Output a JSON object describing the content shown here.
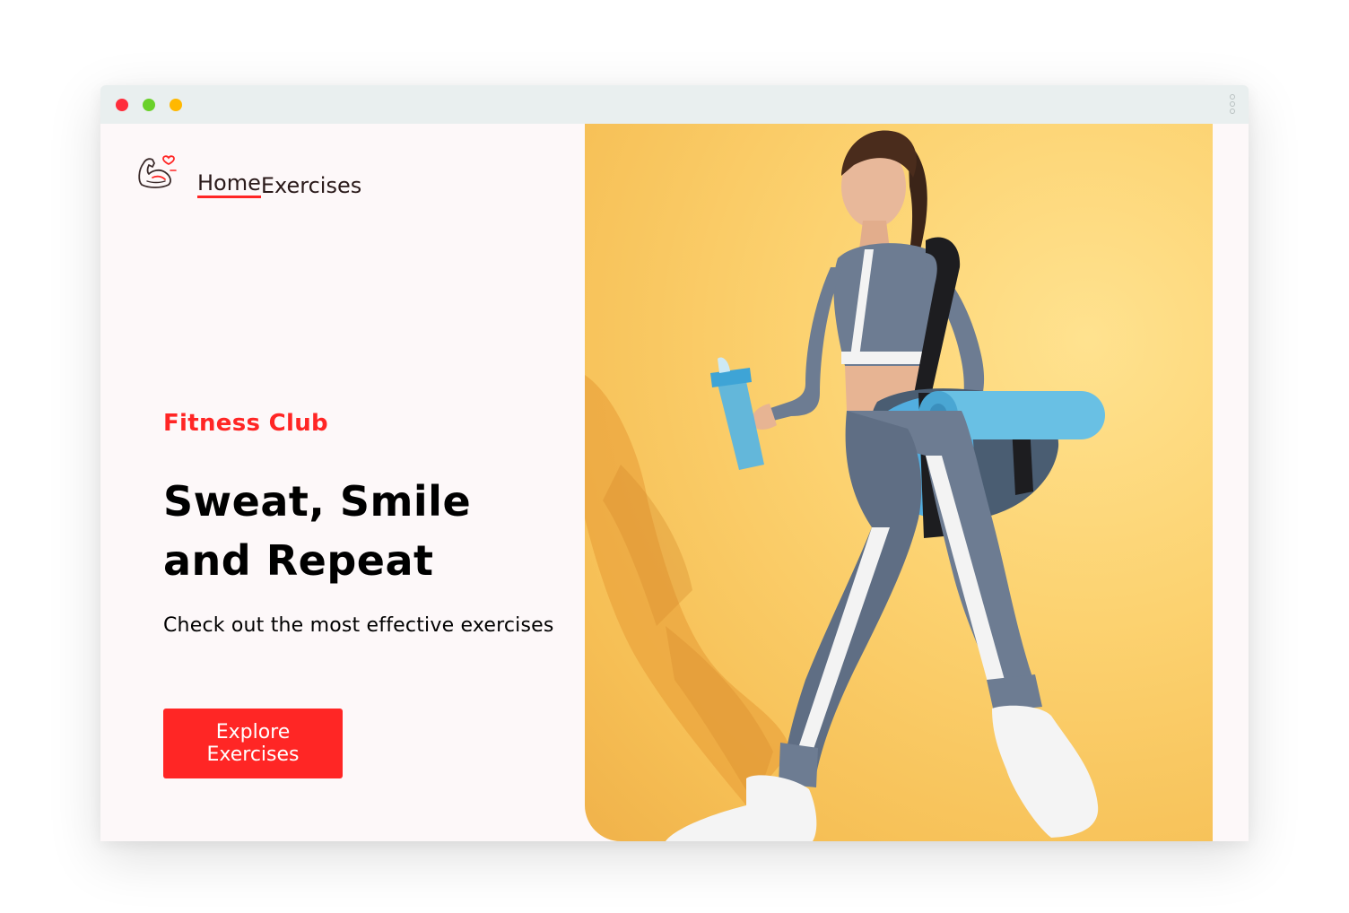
{
  "window": {
    "controls": [
      "close",
      "minimize",
      "maximize"
    ]
  },
  "logo": {
    "icon": "flexed-bicep-heart-icon"
  },
  "nav": {
    "items": [
      {
        "label": "Home",
        "active": true
      },
      {
        "label": "Exercises",
        "active": false
      }
    ]
  },
  "hero": {
    "eyebrow": "Fitness Club",
    "headline_line1": "Sweat, Smile",
    "headline_line2": "and Repeat",
    "subhead": "Check out the most effective exercises",
    "cta_line1": "Explore",
    "cta_line2": "Exercises",
    "image": "woman-walking-with-gym-bag-and-shaker-photo"
  },
  "colors": {
    "accent": "#ff2625",
    "page_background": "#fdf8f9",
    "titlebar": "#e9efef",
    "hero_background": "#fcd270"
  }
}
